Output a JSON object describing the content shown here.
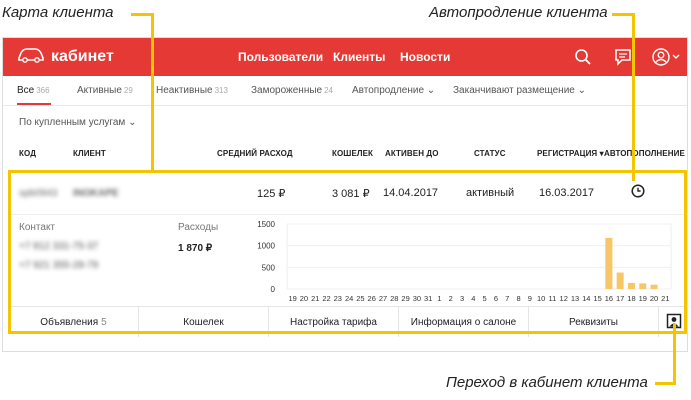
{
  "annotations": {
    "client_card": "Карта клиента",
    "auto_renewal": "Автопродление клиента",
    "goto_cabinet": "Переход в кабинет клиента"
  },
  "header": {
    "brand": "кабинет",
    "nav": [
      "Пользователи",
      "Клиенты",
      "Новости"
    ],
    "color": "#e53935"
  },
  "tabs": [
    {
      "label": "Все",
      "count": "366",
      "active": true
    },
    {
      "label": "Активные",
      "count": "29"
    },
    {
      "label": "Неактивные",
      "count": "313"
    },
    {
      "label": "Замороженные",
      "count": "24"
    },
    {
      "label": "Автопродление",
      "dropdown": true
    },
    {
      "label": "Заканчивают размещение",
      "dropdown": true
    }
  ],
  "filter": {
    "label": "По купленным услугам"
  },
  "columns": [
    "КОД",
    "КЛИЕНТ",
    "СРЕДНИЙ РАСХОД",
    "КОШЕЛЕК",
    "АКТИВЕН ДО",
    "СТАТУС",
    "РЕГИСТРАЦИЯ",
    "АВТОПОПОЛНЕНИЕ"
  ],
  "sort_indicator": "▾",
  "row": {
    "code": "spb0943",
    "client": "INOKAPE",
    "avg_spend": "125 ₽",
    "wallet": "3 081 ₽",
    "active_until": "14.04.2017",
    "status": "активный",
    "registered": "16.03.2017"
  },
  "details": {
    "contact_label": "Контакт",
    "phones": [
      "+7 812 331-75-37",
      "+7 921 355-28-79"
    ],
    "expenses_label": "Расходы",
    "expenses_total": "1 870 ₽"
  },
  "chart_data": {
    "type": "bar",
    "categories": [
      "19",
      "20",
      "21",
      "22",
      "23",
      "24",
      "25",
      "26",
      "27",
      "28",
      "29",
      "30",
      "31",
      "1",
      "2",
      "3",
      "4",
      "5",
      "6",
      "7",
      "8",
      "9",
      "10",
      "11",
      "12",
      "13",
      "14",
      "15",
      "16",
      "17",
      "18",
      "19",
      "20",
      "21"
    ],
    "values": [
      0,
      0,
      0,
      0,
      0,
      0,
      0,
      0,
      0,
      0,
      0,
      0,
      0,
      0,
      0,
      0,
      0,
      0,
      0,
      0,
      0,
      0,
      0,
      0,
      0,
      0,
      0,
      0,
      1180,
      380,
      140,
      130,
      100,
      0
    ],
    "yticks": [
      "1500",
      "1000",
      "500",
      "0"
    ],
    "ylim": [
      0,
      1500
    ],
    "bar_color": "#f7c667"
  },
  "bottom_tabs": [
    {
      "label": "Объявления",
      "count": "5"
    },
    {
      "label": "Кошелек"
    },
    {
      "label": "Настройка тарифа"
    },
    {
      "label": "Информация о салоне"
    },
    {
      "label": "Реквизиты"
    }
  ],
  "icons": {
    "logo": "car-icon",
    "search": "search-icon",
    "messages": "chat-icon",
    "account": "user-icon",
    "clock": "clock-icon",
    "cabinet": "person-card-icon"
  }
}
